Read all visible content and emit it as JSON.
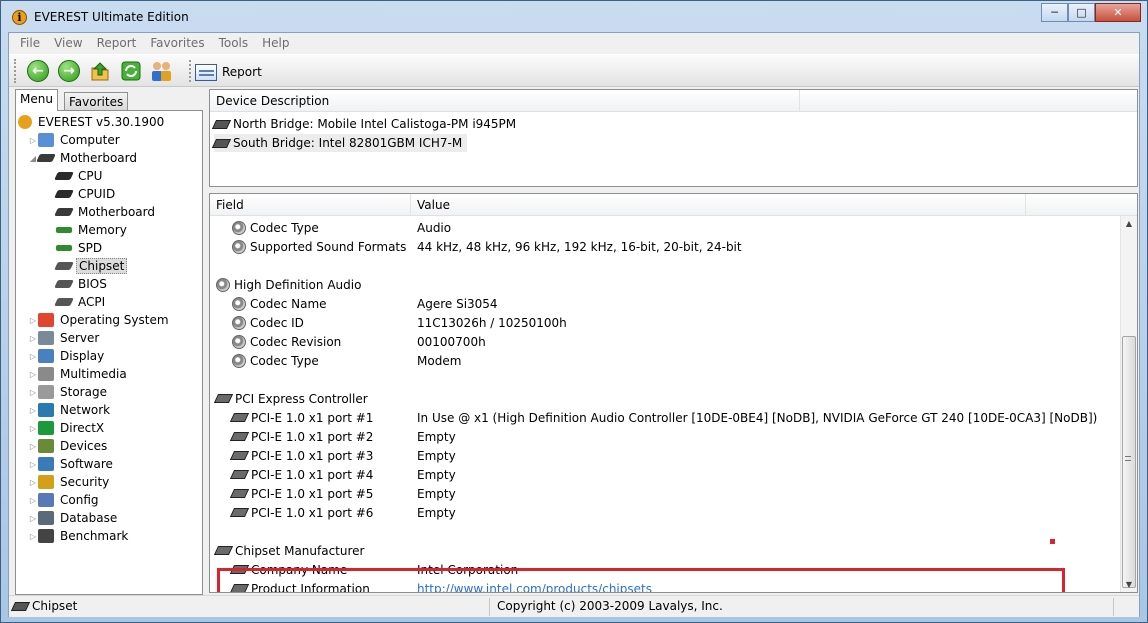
{
  "window": {
    "title": "EVEREST Ultimate Edition"
  },
  "menu": [
    "File",
    "View",
    "Report",
    "Favorites",
    "Tools",
    "Help"
  ],
  "toolbar": {
    "report_label": "Report"
  },
  "left": {
    "tabs": [
      "Menu",
      "Favorites"
    ],
    "tree": [
      {
        "label": "EVEREST v5.30.1900",
        "level": 0,
        "icon": "info-icon",
        "expander": ""
      },
      {
        "label": "Computer",
        "level": 1,
        "icon": "computer-icon",
        "expander": "collapsed"
      },
      {
        "label": "Motherboard",
        "level": 1,
        "icon": "motherboard-icon",
        "expander": "expanded"
      },
      {
        "label": "CPU",
        "level": 2,
        "icon": "cpu-icon",
        "expander": ""
      },
      {
        "label": "CPUID",
        "level": 2,
        "icon": "cpu-icon",
        "expander": ""
      },
      {
        "label": "Motherboard",
        "level": 2,
        "icon": "motherboard-icon",
        "expander": ""
      },
      {
        "label": "Memory",
        "level": 2,
        "icon": "memory-icon",
        "expander": ""
      },
      {
        "label": "SPD",
        "level": 2,
        "icon": "memory-icon",
        "expander": ""
      },
      {
        "label": "Chipset",
        "level": 2,
        "icon": "chip-icon",
        "expander": "",
        "selected": true
      },
      {
        "label": "BIOS",
        "level": 2,
        "icon": "chip-icon",
        "expander": ""
      },
      {
        "label": "ACPI",
        "level": 2,
        "icon": "chip-icon",
        "expander": ""
      },
      {
        "label": "Operating System",
        "level": 1,
        "icon": "windows-icon",
        "expander": "collapsed"
      },
      {
        "label": "Server",
        "level": 1,
        "icon": "server-icon",
        "expander": "collapsed"
      },
      {
        "label": "Display",
        "level": 1,
        "icon": "display-icon",
        "expander": "collapsed"
      },
      {
        "label": "Multimedia",
        "level": 1,
        "icon": "multimedia-icon",
        "expander": "collapsed"
      },
      {
        "label": "Storage",
        "level": 1,
        "icon": "storage-icon",
        "expander": "collapsed"
      },
      {
        "label": "Network",
        "level": 1,
        "icon": "network-icon",
        "expander": "collapsed"
      },
      {
        "label": "DirectX",
        "level": 1,
        "icon": "directx-icon",
        "expander": "collapsed"
      },
      {
        "label": "Devices",
        "level": 1,
        "icon": "devices-icon",
        "expander": "collapsed"
      },
      {
        "label": "Software",
        "level": 1,
        "icon": "software-icon",
        "expander": "collapsed"
      },
      {
        "label": "Security",
        "level": 1,
        "icon": "shield-icon",
        "expander": "collapsed"
      },
      {
        "label": "Config",
        "level": 1,
        "icon": "config-icon",
        "expander": "collapsed"
      },
      {
        "label": "Database",
        "level": 1,
        "icon": "database-icon",
        "expander": "collapsed"
      },
      {
        "label": "Benchmark",
        "level": 1,
        "icon": "hourglass-icon",
        "expander": "collapsed"
      }
    ]
  },
  "devices": {
    "header": "Device Description",
    "items": [
      {
        "label": "North Bridge: Mobile Intel Calistoga-PM i945PM",
        "selected": false
      },
      {
        "label": "South Bridge: Intel 82801GBM ICH7-M",
        "selected": true
      }
    ]
  },
  "data": {
    "headers": {
      "field": "Field",
      "value": "Value"
    },
    "rows": [
      {
        "type": "item",
        "icon": "speaker-icon",
        "field": "Codec Type",
        "value": "Audio"
      },
      {
        "type": "item",
        "icon": "speaker-icon",
        "field": "Supported Sound Formats",
        "value": "44 kHz, 48 kHz, 96 kHz, 192 kHz, 16-bit, 20-bit, 24-bit"
      },
      {
        "type": "blank"
      },
      {
        "type": "group",
        "icon": "speaker-icon",
        "field": "High Definition Audio",
        "value": ""
      },
      {
        "type": "item",
        "icon": "speaker-icon",
        "field": "Codec Name",
        "value": "Agere Si3054"
      },
      {
        "type": "item",
        "icon": "speaker-icon",
        "field": "Codec ID",
        "value": "11C13026h / 10250100h"
      },
      {
        "type": "item",
        "icon": "speaker-icon",
        "field": "Codec Revision",
        "value": "00100700h"
      },
      {
        "type": "item",
        "icon": "speaker-icon",
        "field": "Codec Type",
        "value": "Modem"
      },
      {
        "type": "blank"
      },
      {
        "type": "group",
        "icon": "pcie-icon",
        "field": "PCI Express Controller",
        "value": ""
      },
      {
        "type": "item",
        "icon": "pcie-icon",
        "field": "PCI-E 1.0 x1 port #1",
        "value": "In Use @ x1  (High Definition Audio Controller [10DE-0BE4] [NoDB], NVIDIA GeForce GT 240 [10DE-0CA3] [NoDB])"
      },
      {
        "type": "item",
        "icon": "pcie-icon",
        "field": "PCI-E 1.0 x1 port #2",
        "value": "Empty"
      },
      {
        "type": "item",
        "icon": "pcie-icon",
        "field": "PCI-E 1.0 x1 port #3",
        "value": "Empty"
      },
      {
        "type": "item",
        "icon": "pcie-icon",
        "field": "PCI-E 1.0 x1 port #4",
        "value": "Empty"
      },
      {
        "type": "item",
        "icon": "pcie-icon",
        "field": "PCI-E 1.0 x1 port #5",
        "value": "Empty"
      },
      {
        "type": "item",
        "icon": "pcie-icon",
        "field": "PCI-E 1.0 x1 port #6",
        "value": "Empty"
      },
      {
        "type": "blank"
      },
      {
        "type": "group",
        "icon": "chip-icon",
        "field": "Chipset Manufacturer",
        "value": ""
      },
      {
        "type": "item",
        "icon": "chip-icon",
        "field": "Company Name",
        "value": "Intel Corporation"
      },
      {
        "type": "item",
        "icon": "chip-icon",
        "field": "Product Information",
        "value": "http://www.intel.com/products/chipsets",
        "link": true
      }
    ]
  },
  "status": {
    "left": "Chipset",
    "right": "Copyright (c) 2003-2009 Lavalys, Inc."
  }
}
